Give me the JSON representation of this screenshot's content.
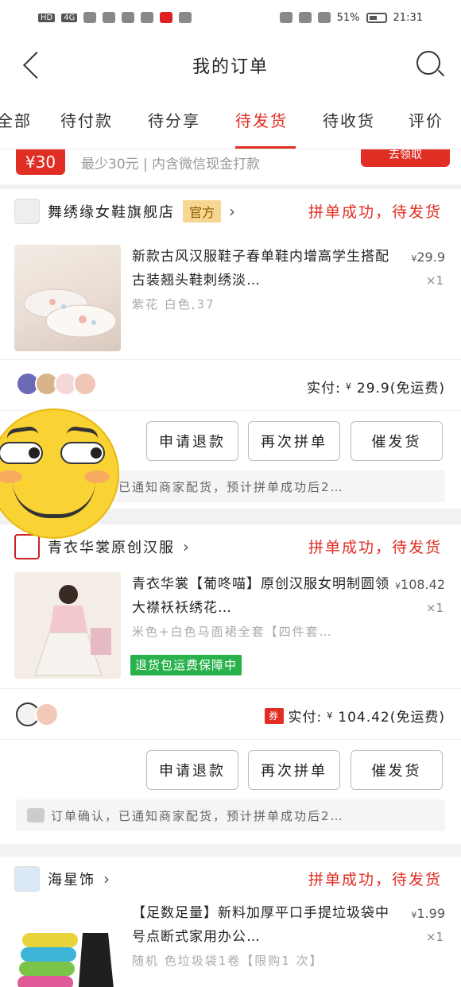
{
  "status_bar": {
    "left": [
      "HD",
      "4G"
    ],
    "battery": "51%",
    "time": "21:31"
  },
  "header": {
    "title": "我的订单"
  },
  "tabs": [
    "全部",
    "待付款",
    "待分享",
    "待发货",
    "待收货",
    "评价"
  ],
  "active_tab": "待发货",
  "coupon": {
    "amount": "¥30",
    "text": "最少30元 | 内含微信现金打款",
    "button": "去领取"
  },
  "orders": [
    {
      "shop": "舞绣缘女鞋旗舰店",
      "official": "官方",
      "status": "拼单成功，待发货",
      "title": "新款古风汉服鞋子春单鞋内增高学生搭配古装翘头鞋刺绣淡…",
      "spec": "紫花 白色,37",
      "price_symbol": "¥",
      "price": "29.9",
      "qty": "×1",
      "paid_label": "实付:",
      "paid_symbol": "¥",
      "paid_amount": "29.9(免运费)",
      "buttons": [
        "申请退款",
        "再次拼单",
        "催发货"
      ],
      "notice": "订单确认，已通知商家配货，预计拼单成功后2…"
    },
    {
      "shop": "青衣华裳原创汉服",
      "status": "拼单成功，待发货",
      "title": "青衣华裳【葡咚喵】原创汉服女明制圆领大襟袄袄绣花…",
      "spec": "米色+白色马面裙全套【四件套…",
      "guarantee": "退货包运费保障中",
      "price_symbol": "¥",
      "price": "108.42",
      "qty": "×1",
      "coupon_tag": "券",
      "paid_label": "实付:",
      "paid_symbol": "¥",
      "paid_amount": "104.42(免运费)",
      "buttons": [
        "申请退款",
        "再次拼单",
        "催发货"
      ],
      "notice": "订单确认，已通知商家配货，预计拼单成功后2…"
    },
    {
      "shop": "海星饰",
      "status": "拼单成功，待发货",
      "title": "【足数足量】新料加厚平口手提垃圾袋中号点断式家用办公…",
      "spec": "随机 色垃圾袋1卷【限购1 次】",
      "price_symbol": "¥",
      "price": "1.99",
      "qty": "×1"
    }
  ],
  "colors": {
    "accent": "#e02e24",
    "green": "#29b24b",
    "gold_badge": "#f6d690"
  }
}
